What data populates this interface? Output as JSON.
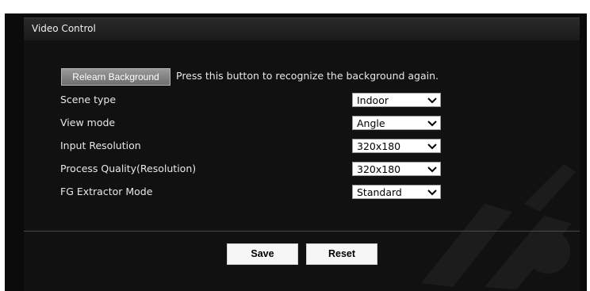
{
  "panel": {
    "title": "Video Control"
  },
  "relearn": {
    "button_label": "Relearn Background",
    "hint": "Press this button to recognize the background again."
  },
  "settings": [
    {
      "label": "Scene type",
      "value": "Indoor"
    },
    {
      "label": "View mode",
      "value": "Angle"
    },
    {
      "label": "Input Resolution",
      "value": "320x180"
    },
    {
      "label": "Process Quality(Resolution)",
      "value": "320x180"
    },
    {
      "label": "FG Extractor Mode",
      "value": "Standard"
    }
  ],
  "footer": {
    "save_label": "Save",
    "reset_label": "Reset"
  },
  "colors": {
    "background": "#111111",
    "text": "#e8e8e8",
    "button_gray": "#8a8a8a"
  },
  "icons": {
    "dropdown": "chevron-down-icon"
  }
}
